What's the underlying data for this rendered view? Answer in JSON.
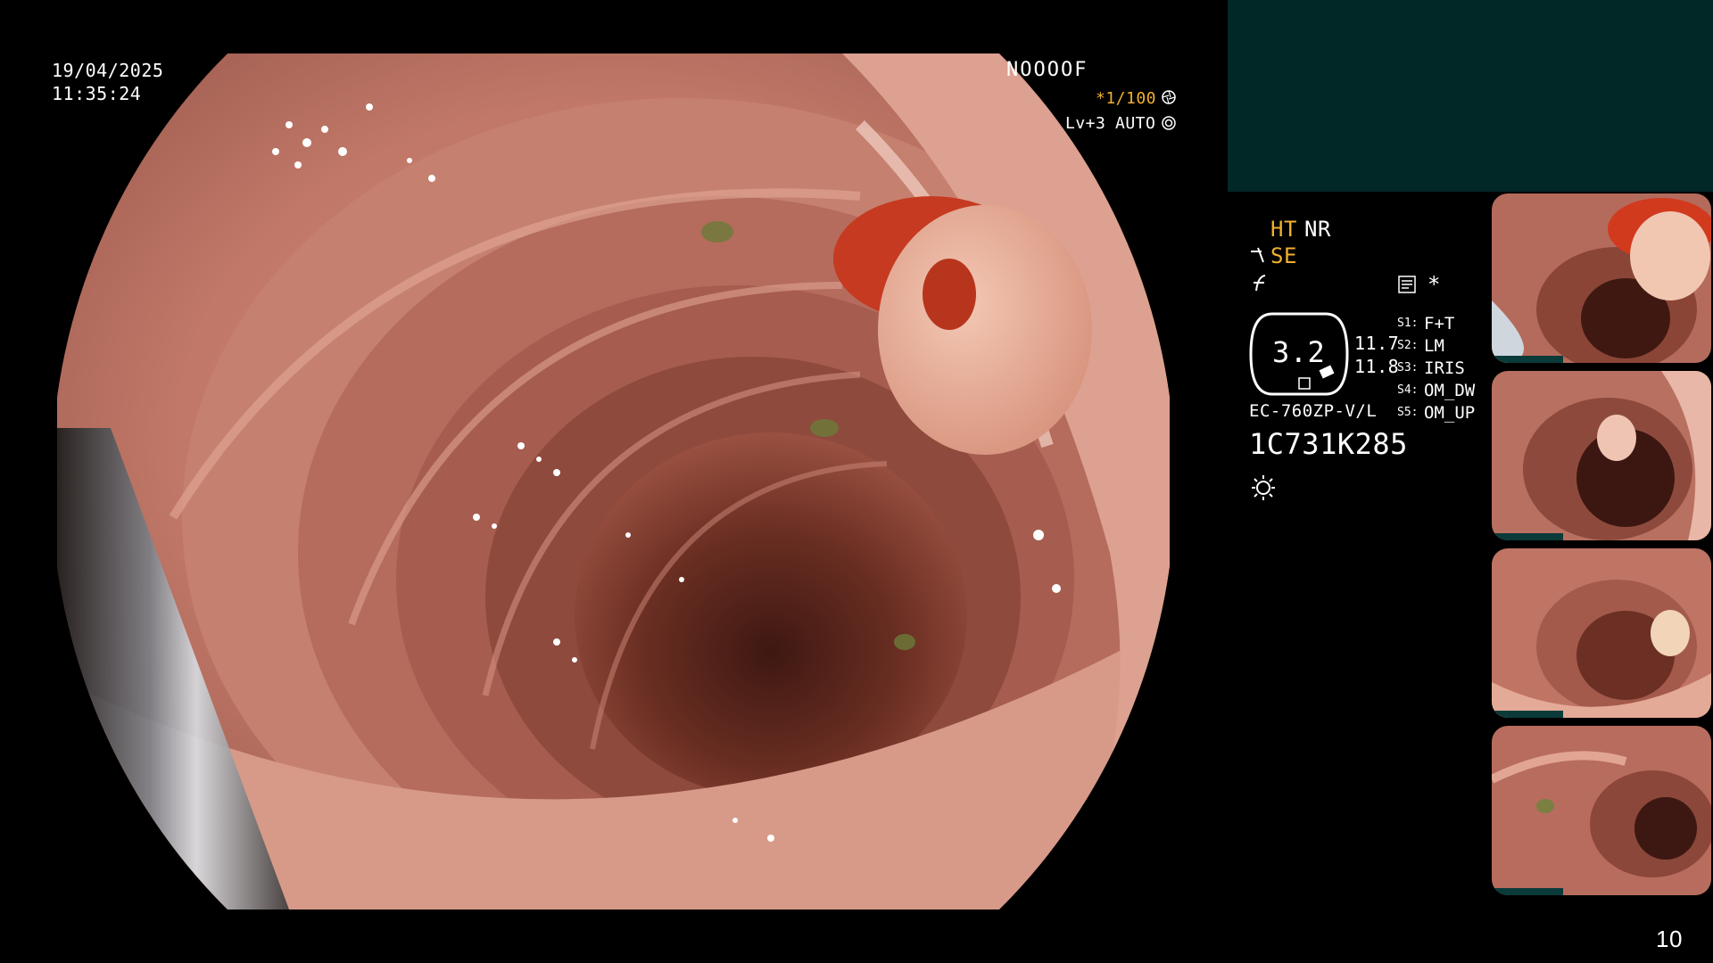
{
  "osd": {
    "date": "19/04/2025",
    "time": "11:35:24",
    "patient_code": "NOOOOF",
    "shutter": "*1/100",
    "level": "Lv+3",
    "mode": "AUTO",
    "ht": "HT",
    "nr": "NR",
    "se": "SE",
    "zoom_value": "3.2",
    "val_top": "11.7",
    "val_bottom": "11.8",
    "model": "EC-760ZP-V/L",
    "serial": "1C731K285",
    "s_keys": [
      "S1:",
      "S2:",
      "S3:",
      "S4:",
      "S5:"
    ],
    "s_values": [
      "F+T",
      "LM",
      "IRIS",
      "OM_DW",
      "OM_UP"
    ],
    "star": "*",
    "page_number": "10"
  },
  "icons": {
    "shutter": "aperture-icon",
    "mode": "iris-icon",
    "se": "structure-enhance-icon",
    "f": "f-signal-icon",
    "memo": "memo-icon",
    "light": "light-icon"
  },
  "colors": {
    "amber": "#f0b030",
    "teal_panel": "#012727",
    "tissue": "#c87c6e",
    "lumen": "#4a1f16"
  }
}
